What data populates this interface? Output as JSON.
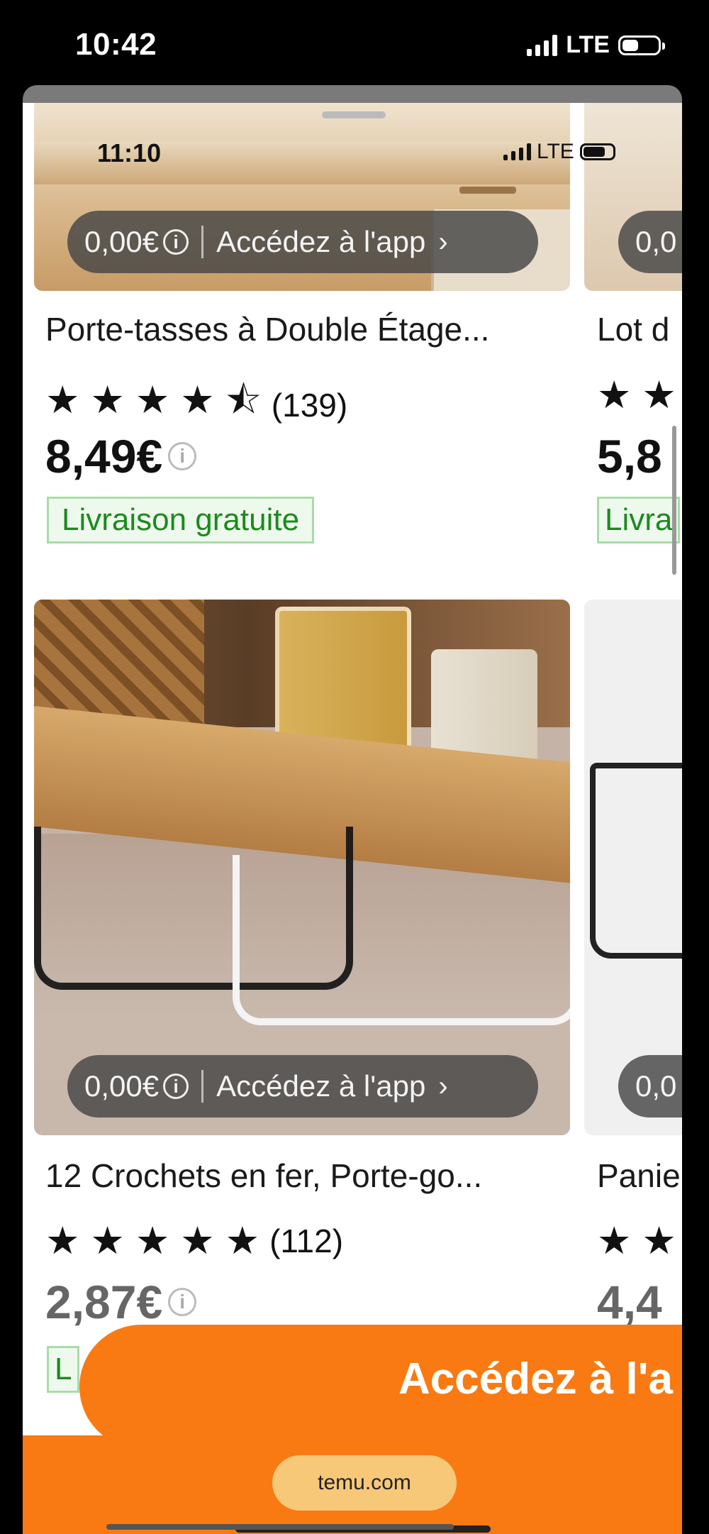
{
  "outer_status": {
    "time": "10:42",
    "network": "LTE"
  },
  "inner_status": {
    "time": "11:10",
    "network": "LTE"
  },
  "products": [
    {
      "price_pill": "0,00€",
      "app_label": "Accédez à l'app",
      "title": "Porte-tasses à Double Étage...",
      "stars": "★ ★ ★ ★ ⯪",
      "reviews": "(139)",
      "price": "8,49€",
      "shipping": "Livraison gratuite"
    },
    {
      "price_pill": "0,00€",
      "app_label": "Accédez à l'app",
      "title": "12 Crochets en fer, Porte-go...",
      "stars": "★ ★ ★ ★ ★",
      "reviews": "(112)",
      "price": "2,87€",
      "shipping": "L"
    }
  ],
  "peek_products": [
    {
      "price_pill": "0,0",
      "title": "Lot d",
      "stars": "★ ★",
      "price": "5,8",
      "shipping": "Livra"
    },
    {
      "price_pill": "0,0",
      "title": "Panie",
      "stars": "★ ★",
      "price": "4,4"
    }
  ],
  "cta": {
    "label": "Accédez à l'a"
  },
  "browser": {
    "url": "temu.com"
  },
  "colors": {
    "brand_orange": "#f97a12",
    "shipping_green": "#1c8a1c"
  }
}
